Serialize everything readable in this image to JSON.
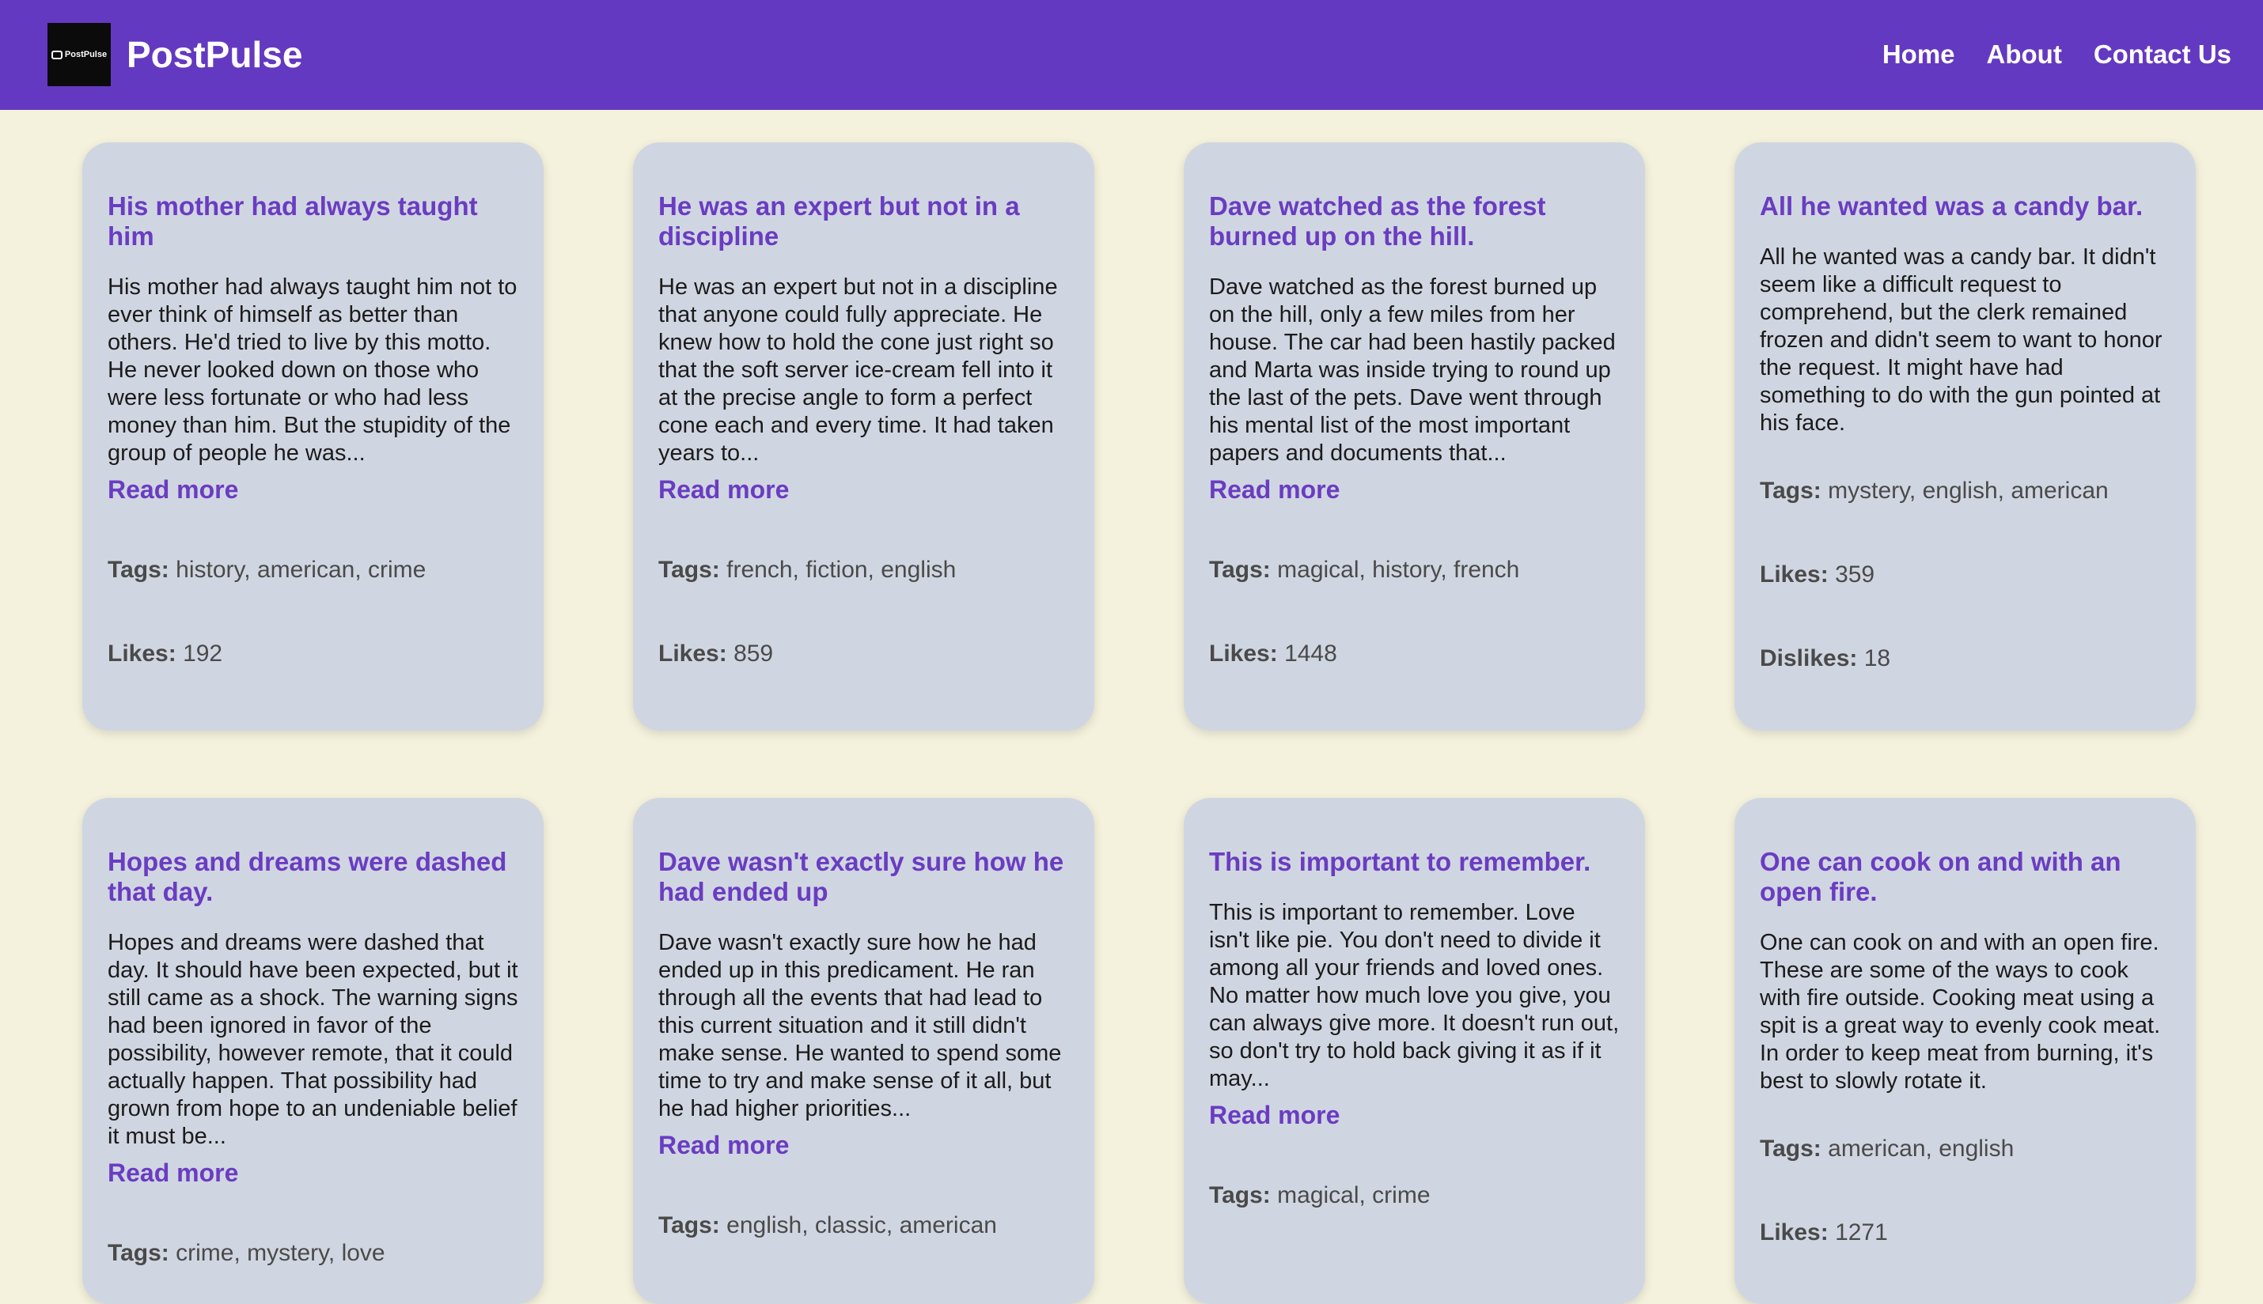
{
  "header": {
    "logo_text": "PostPulse",
    "brand": "PostPulse",
    "nav": [
      "Home",
      "About",
      "Contact Us"
    ]
  },
  "labels": {
    "read_more": "Read more",
    "tags": "Tags:",
    "likes": "Likes:",
    "dislikes": "Dislikes:"
  },
  "posts": [
    {
      "title": "His mother had always taught him",
      "body": "His mother had always taught him not to ever think of himself as better than others. He'd tried to live by this motto. He never looked down on those who were less fortunate or who had less money than him. But the stupidity of the group of people he was...",
      "tags": "history, american, crime",
      "likes": "192"
    },
    {
      "title": "He was an expert but not in a discipline",
      "body": "He was an expert but not in a discipline that anyone could fully appreciate. He knew how to hold the cone just right so that the soft server ice-cream fell into it at the precise angle to form a perfect cone each and every time. It had taken years to...",
      "tags": "french, fiction, english",
      "likes": "859"
    },
    {
      "title": "Dave watched as the forest burned up on the hill.",
      "body": "Dave watched as the forest burned up on the hill, only a few miles from her house. The car had been hastily packed and Marta was inside trying to round up the last of the pets. Dave went through his mental list of the most important papers and documents that...",
      "tags": "magical, history, french",
      "likes": "1448"
    },
    {
      "title": "All he wanted was a candy bar.",
      "body": "All he wanted was a candy bar. It didn't seem like a difficult request to comprehend, but the clerk remained frozen and didn't seem to want to honor the request. It might have had something to do with the gun pointed at his face.",
      "tags": "mystery, english, american",
      "likes": "359",
      "dislikes": "18"
    },
    {
      "title": "Hopes and dreams were dashed that day.",
      "body": "Hopes and dreams were dashed that day. It should have been expected, but it still came as a shock. The warning signs had been ignored in favor of the possibility, however remote, that it could actually happen. That possibility had grown from hope to an undeniable belief it must be...",
      "tags": "crime, mystery, love"
    },
    {
      "title": "Dave wasn't exactly sure how he had ended up",
      "body": "Dave wasn't exactly sure how he had ended up in this predicament. He ran through all the events that had lead to this current situation and it still didn't make sense. He wanted to spend some time to try and make sense of it all, but he had higher priorities...",
      "tags": "english, classic, american"
    },
    {
      "title": "This is important to remember.",
      "body": "This is important to remember. Love isn't like pie. You don't need to divide it among all your friends and loved ones. No matter how much love you give, you can always give more. It doesn't run out, so don't try to hold back giving it as if it may...",
      "tags": "magical, crime"
    },
    {
      "title": "One can cook on and with an open fire.",
      "body": "One can cook on and with an open fire. These are some of the ways to cook with fire outside. Cooking meat using a spit is a great way to evenly cook meat. In order to keep meat from burning, it's best to slowly rotate it.",
      "tags": "american, english",
      "likes": "1271"
    }
  ]
}
